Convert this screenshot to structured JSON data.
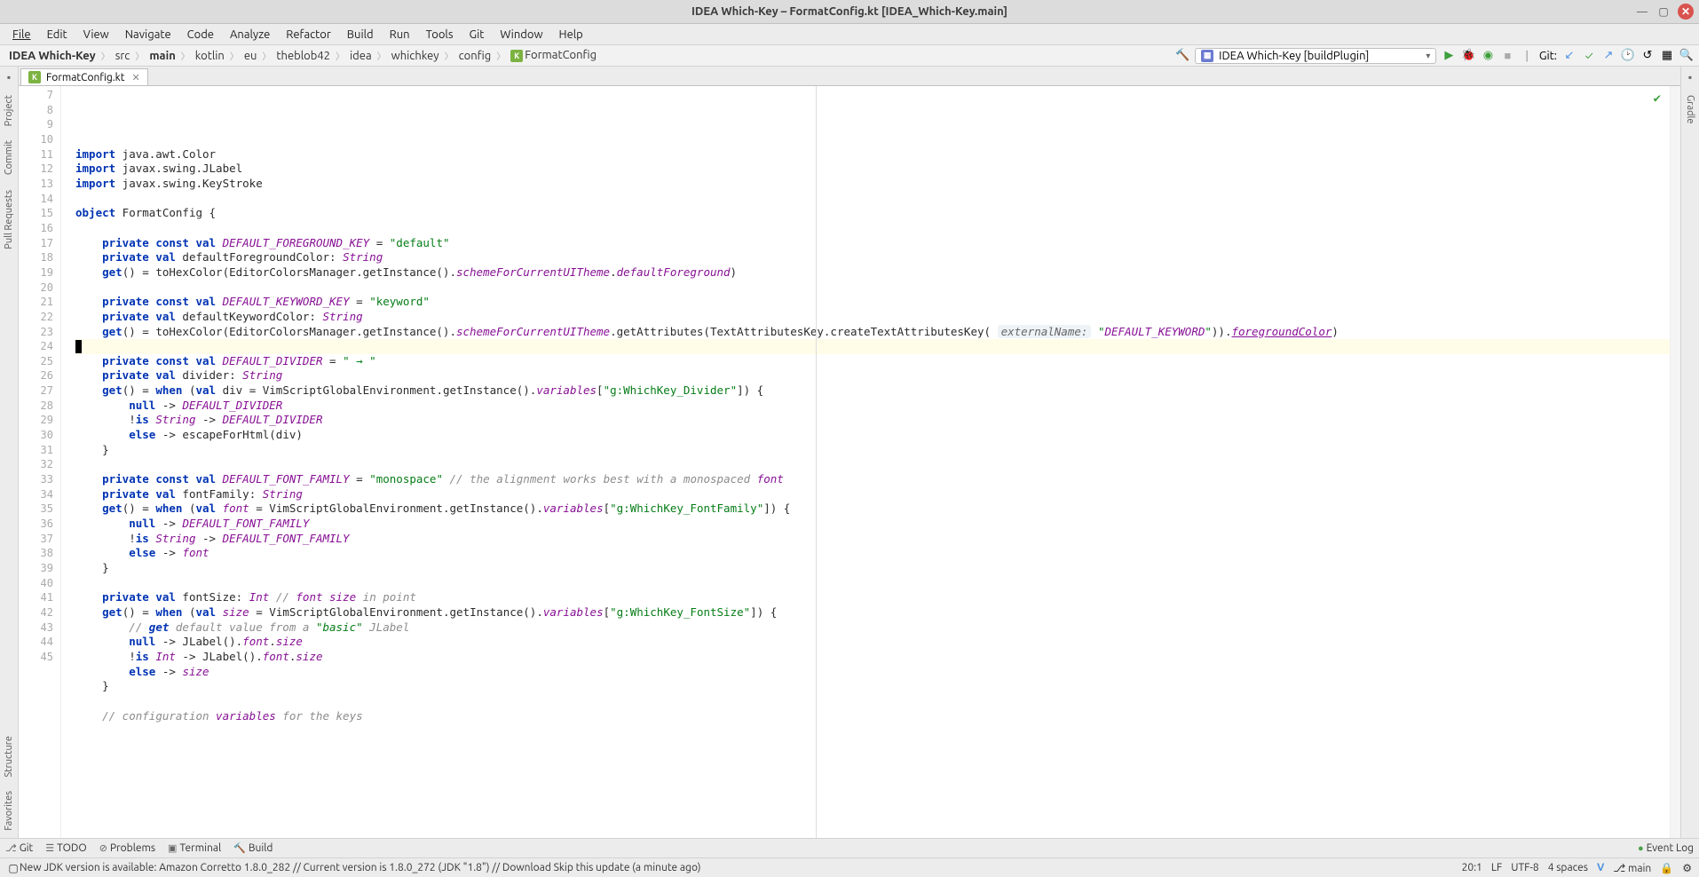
{
  "window": {
    "title": "IDEA Which-Key – FormatConfig.kt [IDEA_Which-Key.main]"
  },
  "menu": [
    "File",
    "Edit",
    "View",
    "Navigate",
    "Code",
    "Analyze",
    "Refactor",
    "Build",
    "Run",
    "Tools",
    "Git",
    "Window",
    "Help"
  ],
  "breadcrumbs": [
    "IDEA Which-Key",
    "src",
    "main",
    "kotlin",
    "eu",
    "theblob42",
    "idea",
    "whichkey",
    "config",
    "FormatConfig"
  ],
  "breadcrumb_bold": [
    0,
    2
  ],
  "run_config": "IDEA Which-Key [buildPlugin]",
  "git_label": "Git:",
  "tab": {
    "name": "FormatConfig.kt"
  },
  "left_rail": [
    "Project",
    "Commit",
    "Pull Requests",
    "Structure",
    "Favorites"
  ],
  "right_rail": [
    "Gradle"
  ],
  "line_start": 7,
  "line_end": 45,
  "cursor_line": 20,
  "bottom_tabs": {
    "git": "Git",
    "todo": "TODO",
    "problems": "Problems",
    "terminal": "Terminal",
    "build": "Build",
    "event_log": "Event Log"
  },
  "status": {
    "msg": "New JDK version is available: Amazon Corretto 1.8.0_282 // Current version is 1.8.0_272 (JDK \"1.8\") // Download   Skip this update (a minute ago)",
    "pos": "20:1",
    "line_sep": "LF",
    "encoding": "UTF-8",
    "indent": "4 spaces",
    "branch": "main"
  },
  "code_lines": [
    "import java.awt.Color",
    "import javax.swing.JLabel",
    "import javax.swing.KeyStroke",
    "",
    "object FormatConfig {",
    "",
    "    private const val DEFAULT_FOREGROUND_KEY = \"default\"",
    "    private val defaultForegroundColor: String",
    "    get() = toHexColor(EditorColorsManager.getInstance().schemeForCurrentUITheme.defaultForeground)",
    "",
    "    private const val DEFAULT_KEYWORD_KEY = \"keyword\"",
    "    private val defaultKeywordColor: String",
    "    get() = toHexColor(EditorColorsManager.getInstance().schemeForCurrentUITheme.getAttributes(TextAttributesKey.createTextAttributesKey( externalName: \"DEFAULT_KEYWORD\")).foregroundColor)",
    "",
    "    private const val DEFAULT_DIVIDER = \" → \"",
    "    private val divider: String",
    "    get() = when (val div = VimScriptGlobalEnvironment.getInstance().variables[\"g:WhichKey_Divider\"]) {",
    "        null -> DEFAULT_DIVIDER",
    "        !is String -> DEFAULT_DIVIDER",
    "        else -> escapeForHtml(div)",
    "    }",
    "",
    "    private const val DEFAULT_FONT_FAMILY = \"monospace\" // the alignment works best with a monospaced font",
    "    private val fontFamily: String",
    "    get() = when (val font = VimScriptGlobalEnvironment.getInstance().variables[\"g:WhichKey_FontFamily\"]) {",
    "        null -> DEFAULT_FONT_FAMILY",
    "        !is String -> DEFAULT_FONT_FAMILY",
    "        else -> font",
    "    }",
    "",
    "    private val fontSize: Int // font size in point",
    "    get() = when (val size = VimScriptGlobalEnvironment.getInstance().variables[\"g:WhichKey_FontSize\"]) {",
    "        // get default value from a \"basic\" JLabel",
    "        null -> JLabel().font.size",
    "        !is Int -> JLabel().font.size",
    "        else -> size",
    "    }",
    "",
    "    // configuration variables for the keys"
  ]
}
